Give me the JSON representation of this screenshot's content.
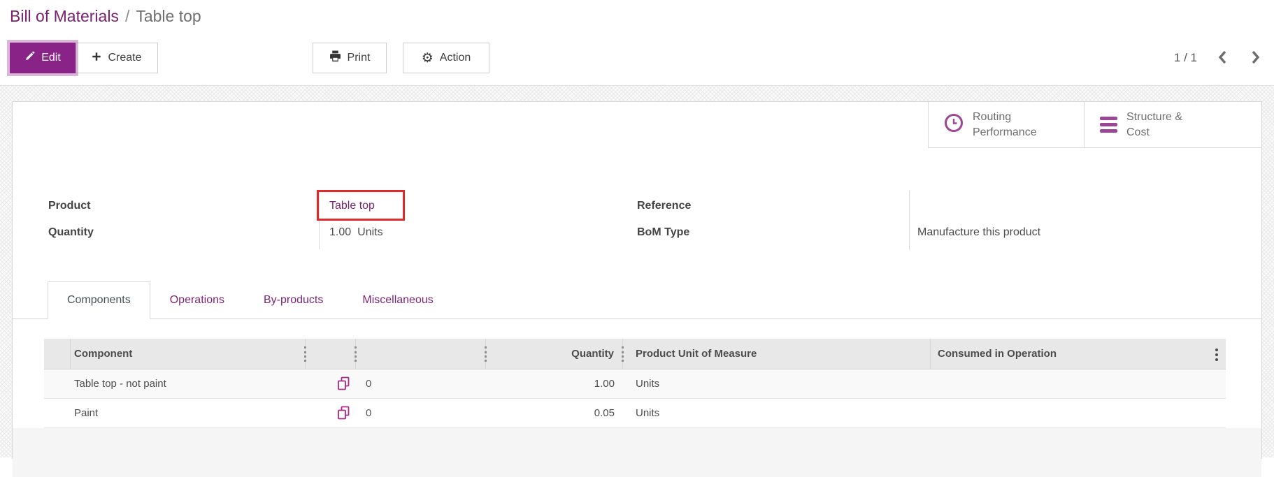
{
  "breadcrumb": {
    "parent": "Bill of Materials",
    "separator": "/",
    "current": "Table top"
  },
  "toolbar": {
    "edit_label": "Edit",
    "create_label": "Create",
    "print_label": "Print",
    "action_label": "Action",
    "pager_value": "1 / 1"
  },
  "smart_buttons": {
    "routing_label": "Routing Performance",
    "structure_label": "Structure & Cost"
  },
  "form": {
    "product_label": "Product",
    "product_value": "Table top",
    "quantity_label": "Quantity",
    "quantity_value": "1.00",
    "quantity_unit": "Units",
    "reference_label": "Reference",
    "bom_type_label": "BoM Type",
    "bom_type_value": "Manufacture this product"
  },
  "tabs": {
    "components": "Components",
    "operations": "Operations",
    "byproducts": "By-products",
    "miscellaneous": "Miscellaneous"
  },
  "components_table": {
    "headers": {
      "component": "Component",
      "quantity": "Quantity",
      "uom": "Product Unit of Measure",
      "consumed": "Consumed in Operation"
    },
    "rows": [
      {
        "name": "Table top - not paint",
        "variants": "0",
        "qty": "1.00",
        "uom": "Units",
        "consumed": ""
      },
      {
        "name": "Paint",
        "variants": "0",
        "qty": "0.05",
        "uom": "Units",
        "consumed": ""
      }
    ]
  },
  "colors": {
    "primary": "#8a2387",
    "link": "#7a2171",
    "smart_icon": "#9c4696",
    "copy_icon": "#a82a8a",
    "annotation": "#df2a2a"
  }
}
